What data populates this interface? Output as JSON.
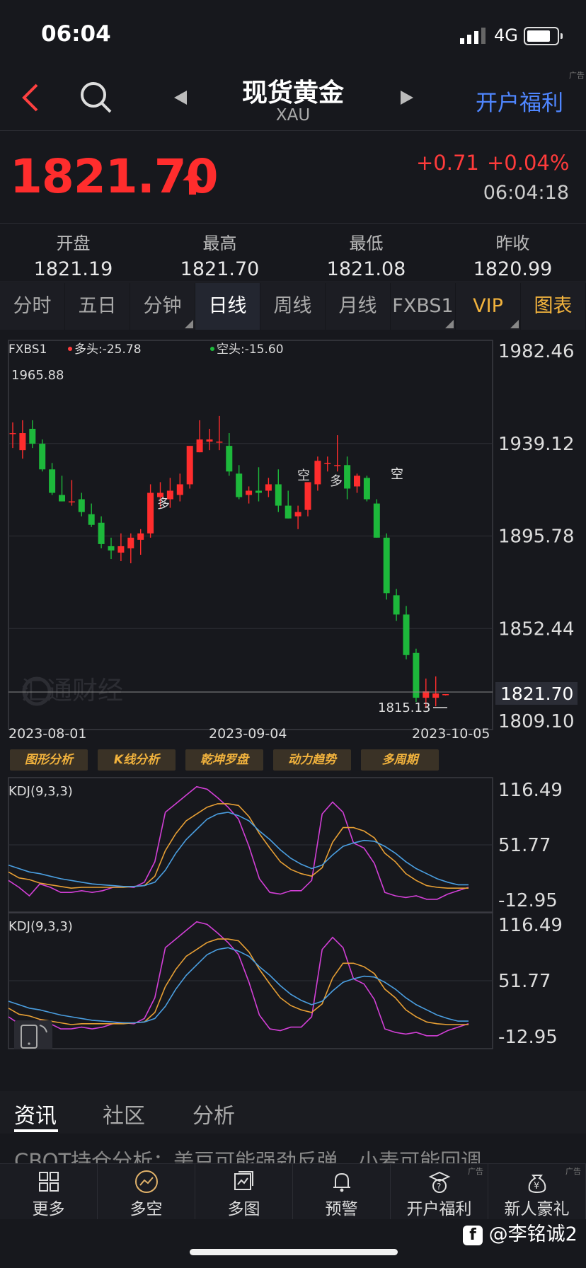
{
  "status_bar": {
    "time": "06:04",
    "network": "4G"
  },
  "nav": {
    "title": "现货黄金",
    "subtitle": "XAU",
    "promo": "开户福利",
    "ad_tag": "广告"
  },
  "quote": {
    "last": "1821.70",
    "change": "+0.71",
    "change_pct": "+0.04%",
    "time": "06:04:18",
    "up_color": "#ff2d2d",
    "down_color": "#1db83b"
  },
  "stats": [
    {
      "label": "开盘",
      "value": "1821.19"
    },
    {
      "label": "最高",
      "value": "1821.70"
    },
    {
      "label": "最低",
      "value": "1821.08"
    },
    {
      "label": "昨收",
      "value": "1820.99"
    }
  ],
  "tabs": [
    "分时",
    "五日",
    "分钟",
    "日线",
    "周线",
    "月线",
    "FXBS1",
    "VIP",
    "图表"
  ],
  "active_tab": "日线",
  "chart_data": [
    {
      "type": "candlestick",
      "indicator_name": "FXBS1",
      "legend": [
        {
          "label": "多头:-25.78",
          "color": "#ff3b3b"
        },
        {
          "label": "空头:-15.60",
          "color": "#1db83b"
        }
      ],
      "y_ticks": [
        "1982.46",
        "1939.12",
        "1895.78",
        "1852.44",
        "1809.10"
      ],
      "ylim": [
        1809.1,
        1982.46
      ],
      "current_price_label": "1821.70",
      "high_annotation": "1965.88",
      "low_annotation": "1815.13",
      "signals": [
        "空",
        "多",
        "多",
        "空"
      ],
      "x_ticks": [
        "2023-08-01",
        "2023-09-04",
        "2023-10-05"
      ],
      "watermark": "汇通财经",
      "candles": [
        {
          "o": 1944,
          "h": 1949,
          "l": 1937,
          "c": 1944
        },
        {
          "o": 1936,
          "h": 1950,
          "l": 1932,
          "c": 1944
        },
        {
          "o": 1946,
          "h": 1950,
          "l": 1937,
          "c": 1939
        },
        {
          "o": 1939,
          "h": 1941,
          "l": 1926,
          "c": 1927
        },
        {
          "o": 1927,
          "h": 1930,
          "l": 1915,
          "c": 1916
        },
        {
          "o": 1915,
          "h": 1924,
          "l": 1912,
          "c": 1912
        },
        {
          "o": 1912,
          "h": 1922,
          "l": 1910,
          "c": 1912
        },
        {
          "o": 1913,
          "h": 1916,
          "l": 1905,
          "c": 1907
        },
        {
          "o": 1906,
          "h": 1911,
          "l": 1900,
          "c": 1901
        },
        {
          "o": 1902,
          "h": 1905,
          "l": 1890,
          "c": 1892
        },
        {
          "o": 1891,
          "h": 1895,
          "l": 1885,
          "c": 1889
        },
        {
          "o": 1888,
          "h": 1897,
          "l": 1884,
          "c": 1891
        },
        {
          "o": 1890,
          "h": 1897,
          "l": 1883,
          "c": 1895
        },
        {
          "o": 1894,
          "h": 1899,
          "l": 1887,
          "c": 1897
        },
        {
          "o": 1897,
          "h": 1920,
          "l": 1895,
          "c": 1916
        },
        {
          "o": 1914,
          "h": 1921,
          "l": 1909,
          "c": 1916
        },
        {
          "o": 1913,
          "h": 1923,
          "l": 1909,
          "c": 1917
        },
        {
          "o": 1915,
          "h": 1925,
          "l": 1912,
          "c": 1920
        },
        {
          "o": 1920,
          "h": 1936,
          "l": 1918,
          "c": 1938
        },
        {
          "o": 1935,
          "h": 1950,
          "l": 1935,
          "c": 1941
        },
        {
          "o": 1940,
          "h": 1946,
          "l": 1936,
          "c": 1941
        },
        {
          "o": 1940,
          "h": 1952,
          "l": 1936,
          "c": 1940
        },
        {
          "o": 1938,
          "h": 1944,
          "l": 1924,
          "c": 1926
        },
        {
          "o": 1925,
          "h": 1929,
          "l": 1913,
          "c": 1914
        },
        {
          "o": 1915,
          "h": 1919,
          "l": 1911,
          "c": 1917
        },
        {
          "o": 1917,
          "h": 1928,
          "l": 1912,
          "c": 1916
        },
        {
          "o": 1917,
          "h": 1923,
          "l": 1914,
          "c": 1920
        },
        {
          "o": 1920,
          "h": 1927,
          "l": 1907,
          "c": 1910
        },
        {
          "o": 1910,
          "h": 1917,
          "l": 1904,
          "c": 1904
        },
        {
          "o": 1905,
          "h": 1910,
          "l": 1899,
          "c": 1907
        },
        {
          "o": 1908,
          "h": 1921,
          "l": 1905,
          "c": 1921
        },
        {
          "o": 1920,
          "h": 1933,
          "l": 1917,
          "c": 1931
        },
        {
          "o": 1930,
          "h": 1933,
          "l": 1926,
          "c": 1930
        },
        {
          "o": 1929,
          "h": 1943,
          "l": 1926,
          "c": 1929
        },
        {
          "o": 1929,
          "h": 1933,
          "l": 1913,
          "c": 1918
        },
        {
          "o": 1919,
          "h": 1925,
          "l": 1916,
          "c": 1924
        },
        {
          "o": 1923,
          "h": 1924,
          "l": 1912,
          "c": 1913
        },
        {
          "o": 1911,
          "h": 1913,
          "l": 1895,
          "c": 1895
        },
        {
          "o": 1895,
          "h": 1897,
          "l": 1866,
          "c": 1869
        },
        {
          "o": 1868,
          "h": 1871,
          "l": 1856,
          "c": 1859
        },
        {
          "o": 1859,
          "h": 1863,
          "l": 1838,
          "c": 1840
        },
        {
          "o": 1841,
          "h": 1843,
          "l": 1818,
          "c": 1820
        },
        {
          "o": 1820,
          "h": 1829,
          "l": 1815.13,
          "c": 1823
        },
        {
          "o": 1820,
          "h": 1830,
          "l": 1816,
          "c": 1822
        },
        {
          "o": 1821.19,
          "h": 1821.7,
          "l": 1821.08,
          "c": 1821.7
        }
      ]
    },
    {
      "type": "line",
      "title": "KDJ(9,3,3)",
      "y_ticks": [
        "116.49",
        "51.77",
        "-12.95"
      ],
      "ylim": [
        -12.95,
        116.49
      ],
      "series": [
        {
          "color": "#d23fd6",
          "values": [
            10,
            2,
            -8,
            6,
            2,
            -4,
            -4,
            -2,
            -4,
            -2,
            2,
            3,
            2,
            8,
            32,
            90,
            100,
            110,
            120,
            117,
            107,
            96,
            82,
            50,
            12,
            -4,
            -6,
            -2,
            -2,
            10,
            88,
            102,
            90,
            54,
            48,
            30,
            -4,
            -8,
            -10,
            -8,
            -12,
            -12,
            -6,
            -2,
            2
          ]
        },
        {
          "color": "#e79f34",
          "values": [
            20,
            13,
            11,
            7,
            5,
            3,
            1,
            2,
            2,
            2,
            2,
            2,
            3,
            4,
            15,
            45,
            65,
            80,
            88,
            96,
            100,
            100,
            98,
            85,
            65,
            48,
            32,
            23,
            18,
            15,
            25,
            55,
            72,
            72,
            68,
            60,
            42,
            32,
            18,
            10,
            4,
            2,
            1,
            1,
            1
          ]
        },
        {
          "color": "#4a9ee0",
          "values": [
            28,
            24,
            20,
            18,
            15,
            12,
            10,
            8,
            6,
            5,
            4,
            3,
            3,
            4,
            8,
            22,
            42,
            58,
            70,
            82,
            88,
            90,
            86,
            80,
            68,
            58,
            46,
            36,
            29,
            24,
            28,
            40,
            50,
            54,
            57,
            56,
            50,
            42,
            32,
            24,
            18,
            12,
            8,
            5,
            5
          ]
        }
      ]
    },
    {
      "type": "line",
      "title": "KDJ(9,3,3)",
      "y_ticks": [
        "116.49",
        "51.77",
        "-12.95"
      ],
      "ylim": [
        -12.95,
        116.49
      ],
      "series": [
        {
          "color": "#d23fd6",
          "values": [
            10,
            2,
            -8,
            6,
            2,
            -4,
            -4,
            -2,
            -4,
            -2,
            2,
            3,
            2,
            8,
            32,
            90,
            100,
            110,
            120,
            117,
            107,
            96,
            82,
            50,
            12,
            -4,
            -6,
            -2,
            -2,
            10,
            88,
            102,
            90,
            54,
            48,
            30,
            -4,
            -8,
            -10,
            -8,
            -12,
            -12,
            -6,
            -2,
            2
          ]
        },
        {
          "color": "#e79f34",
          "values": [
            20,
            13,
            11,
            7,
            5,
            3,
            1,
            2,
            2,
            2,
            2,
            2,
            3,
            4,
            15,
            45,
            65,
            80,
            88,
            96,
            100,
            100,
            98,
            85,
            65,
            48,
            32,
            23,
            18,
            15,
            25,
            55,
            72,
            72,
            68,
            60,
            42,
            32,
            18,
            10,
            4,
            2,
            1,
            1,
            1
          ]
        },
        {
          "color": "#4a9ee0",
          "values": [
            28,
            24,
            20,
            18,
            15,
            12,
            10,
            8,
            6,
            5,
            4,
            3,
            3,
            4,
            8,
            22,
            42,
            58,
            70,
            82,
            88,
            90,
            86,
            80,
            68,
            58,
            46,
            36,
            29,
            24,
            28,
            40,
            50,
            54,
            57,
            56,
            50,
            42,
            32,
            24,
            18,
            12,
            8,
            5,
            5
          ]
        }
      ]
    }
  ],
  "analysis_tools": [
    "图形分析",
    "K线分析",
    "乾坤罗盘",
    "动力趋势",
    "多周期"
  ],
  "news": {
    "tabs": [
      "资讯",
      "社区",
      "分析"
    ],
    "active": "资讯",
    "headline": "CBOT持仓分析：美豆可能强劲反弹，小麦可能回调"
  },
  "bottom_bar": [
    {
      "label": "更多",
      "icon": "grid-icon",
      "ad": ""
    },
    {
      "label": "多空",
      "icon": "trend-icon",
      "ad": ""
    },
    {
      "label": "多图",
      "icon": "multi-chart-icon",
      "ad": ""
    },
    {
      "label": "预警",
      "icon": "bell-icon",
      "ad": ""
    },
    {
      "label": "开户福利",
      "icon": "gift-account-icon",
      "ad": "广告"
    },
    {
      "label": "新人豪礼",
      "icon": "money-bag-icon",
      "ad": "广告"
    }
  ],
  "watermark_user": "@李铭诚2"
}
